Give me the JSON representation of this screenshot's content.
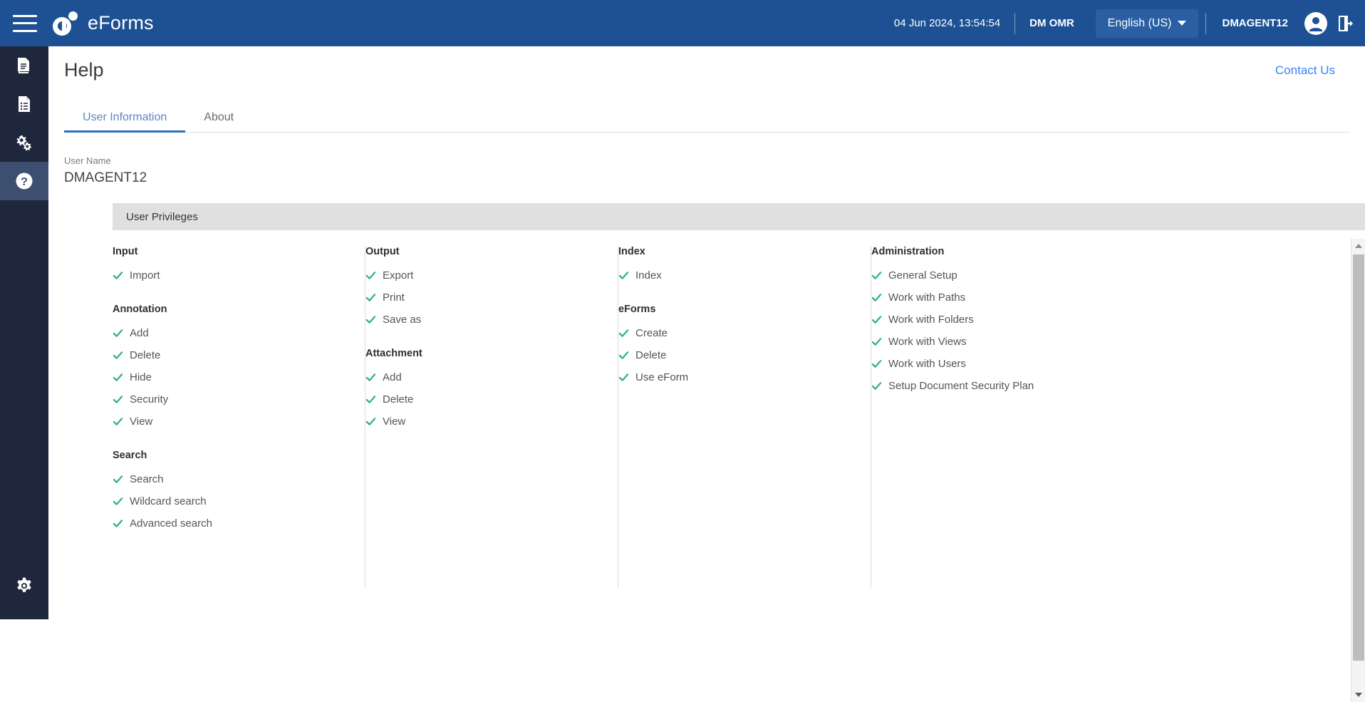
{
  "app": {
    "brand_name": "eForms",
    "accent_blue": "#1e5193",
    "sidebar_dark": "#1f273c",
    "check_green": "#2fb573",
    "link_blue": "#3b82f6"
  },
  "header": {
    "menu_icon": "hamburger-icon",
    "datetime": "04 Jun 2024, 13:54:54",
    "tenant": "DM OMR",
    "language": "English (US)",
    "username": "DMAGENT12",
    "avatar_icon": "user-avatar-icon",
    "logout_icon": "logout-icon"
  },
  "sidebar": {
    "items": [
      {
        "name": "documents-icon",
        "active": false
      },
      {
        "name": "document-list-icon",
        "active": false
      },
      {
        "name": "gears-icon",
        "active": false
      },
      {
        "name": "help-icon",
        "active": true
      }
    ],
    "bottom_item": {
      "name": "settings-gear-icon"
    }
  },
  "page": {
    "title": "Help",
    "contact_link": "Contact Us",
    "tabs": [
      {
        "label": "User Information",
        "active": true
      },
      {
        "label": "About",
        "active": false
      }
    ]
  },
  "user_info": {
    "user_name_label": "User Name",
    "user_name_value": "DMAGENT12"
  },
  "privileges": {
    "section_title": "User Privileges",
    "columns": [
      {
        "groups": [
          {
            "title": "Input",
            "items": [
              "Import"
            ]
          },
          {
            "title": "Annotation",
            "items": [
              "Add",
              "Delete",
              "Hide",
              "Security",
              "View"
            ]
          },
          {
            "title": "Search",
            "items": [
              "Search",
              "Wildcard search",
              "Advanced search"
            ]
          }
        ]
      },
      {
        "groups": [
          {
            "title": "Output",
            "items": [
              "Export",
              "Print",
              "Save as"
            ]
          },
          {
            "title": "Attachment",
            "items": [
              "Add",
              "Delete",
              "View"
            ]
          }
        ]
      },
      {
        "groups": [
          {
            "title": "Index",
            "items": [
              "Index"
            ]
          },
          {
            "title": "eForms",
            "items": [
              "Create",
              "Delete",
              "Use eForm"
            ]
          }
        ]
      },
      {
        "groups": [
          {
            "title": "Administration",
            "items": [
              "General Setup",
              "Work with Paths",
              "Work with Folders",
              "Work with Views",
              "Work with Users",
              "Setup Document Security Plan"
            ]
          }
        ]
      }
    ]
  },
  "scrollbar": {
    "up_icon": "scroll-up-arrow-icon",
    "down_icon": "scroll-down-arrow-icon"
  }
}
